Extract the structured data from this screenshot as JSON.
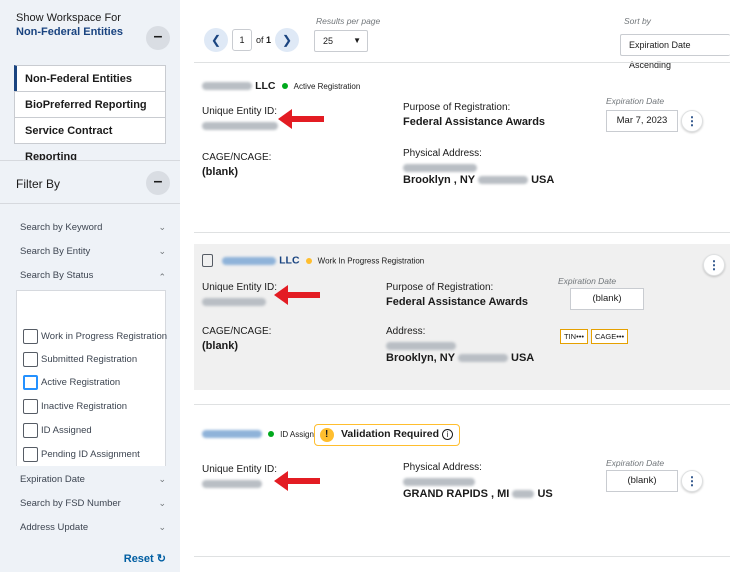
{
  "sidebar": {
    "workspace_title": "Show Workspace For",
    "workspace_selected": "Non-Federal Entities",
    "workspace_items": [
      "Non-Federal Entities",
      "BioPreferred Reporting",
      "Service Contract Reporting"
    ],
    "collapse_symbol": "–",
    "filter_by": "Filter By",
    "filters_top": [
      "Search by Keyword",
      "Search By Entity",
      "Search By Status"
    ],
    "status_options": [
      "Work in Progress Registration",
      "Submitted Registration",
      "Active Registration",
      "Inactive Registration",
      "ID Assigned",
      "Pending ID Assignment"
    ],
    "filters_bottom": [
      "Expiration Date",
      "Search by FSD Number",
      "Address Update"
    ],
    "reset_label": "Reset"
  },
  "pager": {
    "page": "1",
    "of_text": "of",
    "total": "1",
    "results_label": "Results per page",
    "results_value": "25",
    "sort_label": "Sort by",
    "sort_value": "Expiration Date Ascending"
  },
  "cards": [
    {
      "name_suffix": "LLC",
      "status": "Active Registration",
      "status_color": "#00a91c",
      "uei_label": "Unique Entity ID:",
      "purpose_label": "Purpose of Registration:",
      "purpose_value": "Federal Assistance Awards",
      "exp_label": "Expiration Date",
      "exp_value": "Mar 7, 2023",
      "cage_label": "CAGE/NCAGE:",
      "cage_value": "(blank)",
      "addr_label": "Physical Address:",
      "addr_city": "Brooklyn , NY",
      "addr_country": "USA"
    },
    {
      "name_suffix": "LLC",
      "status": "Work In Progress Registration",
      "status_color": "#ffbe2e",
      "uei_label": "Unique Entity ID:",
      "purpose_label": "Purpose of Registration:",
      "purpose_value": "Federal Assistance Awards",
      "exp_label": "Expiration Date",
      "exp_value": "(blank)",
      "cage_label": "CAGE/NCAGE:",
      "cage_value": "(blank)",
      "addr_label": "Address:",
      "addr_city": "Brooklyn, NY",
      "addr_country": "USA",
      "tags": [
        "TIN•••",
        "CAGE•••"
      ]
    },
    {
      "status": "ID Assigned",
      "status_color": "#00a91c",
      "validation": "Validation Required",
      "uei_label": "Unique Entity ID:",
      "addr_label": "Physical Address:",
      "addr_city": "GRAND RAPIDS , MI",
      "addr_country": "US",
      "exp_label": "Expiration Date",
      "exp_value": "(blank)"
    }
  ],
  "icons": {
    "prev": "chevron-left-icon",
    "next": "chevron-right-icon",
    "more": "more-vertical-icon",
    "warning": "warning-icon",
    "info": "info-icon",
    "reset": "reset-icon",
    "document": "document-icon",
    "arrow": "red-arrow-icon"
  },
  "colors": {
    "accent": "#1a4480",
    "arrow": "#e31c23",
    "active": "#00a91c",
    "wip": "#ffbe2e"
  }
}
